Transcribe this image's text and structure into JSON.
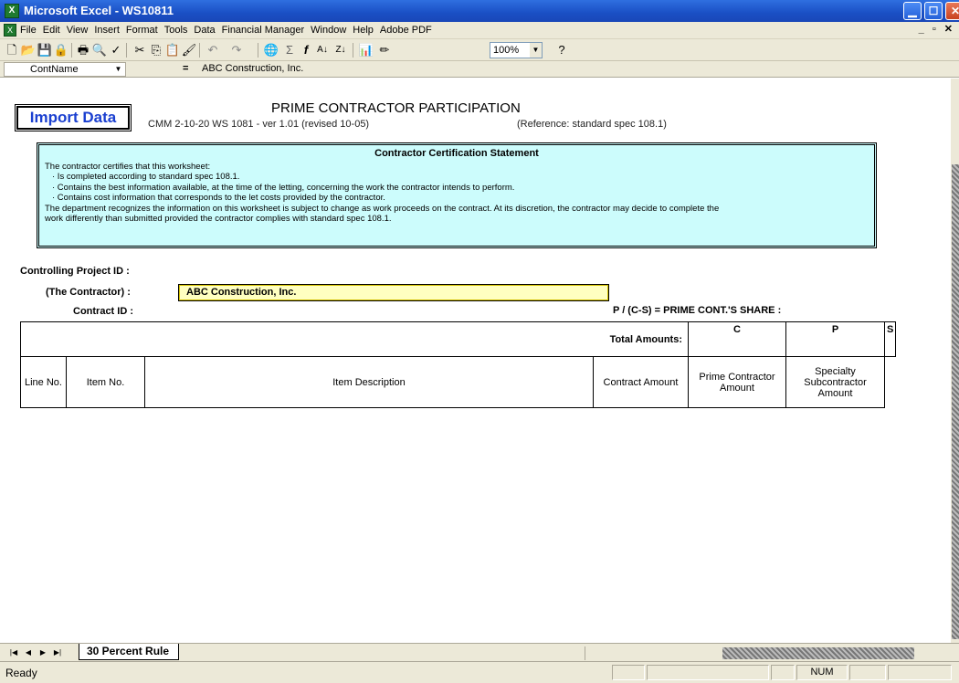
{
  "window": {
    "title": "Microsoft Excel - WS10811",
    "app_icon": "excel-icon",
    "controls": [
      "minimize",
      "maximize",
      "close"
    ]
  },
  "menu": {
    "items": [
      "File",
      "Edit",
      "View",
      "Insert",
      "Format",
      "Tools",
      "Data",
      "Financial Manager",
      "Window",
      "Help",
      "Adobe PDF"
    ]
  },
  "toolbar": {
    "zoom": "100%",
    "icons": [
      "new-icon",
      "open-icon",
      "save-icon",
      "permission-icon",
      "print-icon",
      "print-preview-icon",
      "spelling-icon",
      "cut-icon",
      "copy-icon",
      "paste-icon",
      "format-painter-icon",
      "undo-icon",
      "redo-icon",
      "hyperlink-icon",
      "autosum-icon",
      "function-icon",
      "sort-ascending-icon",
      "sort-descending-icon",
      "chart-wizard-icon",
      "drawing-icon",
      "help-icon"
    ]
  },
  "formula_bar": {
    "name_box": "ContName",
    "equals": "=",
    "content": "ABC Construction, Inc."
  },
  "sheet": {
    "import_button": "Import Data",
    "title": "PRIME CONTRACTOR PARTICIPATION",
    "version": "CMM 2-10-20 WS 1081 - ver 1.01 (revised 10-05)",
    "reference": "(Reference: standard spec 108.1)",
    "certification": {
      "title": "Contractor Certification Statement",
      "lines": [
        "The contractor certifies that this worksheet:",
        "· Is completed according to standard spec 108.1.",
        "· Contains the best information available, at the time of the letting, concerning the work the contractor intends to perform.",
        "· Contains cost information that corresponds to the let costs provided by the contractor.",
        "The department recognizes the information on this worksheet is subject to change as work proceeds on the contract.  At its discretion, the contractor may decide to complete the",
        "work differently than submitted provided the contractor complies with standard spec 108.1."
      ]
    },
    "controlling_project_label": "Controlling Project ID :",
    "contractor_label": "(The Contractor) :",
    "contractor_value": "ABC Construction, Inc.",
    "contract_id_label": "Contract ID :",
    "share_label": "P / (C-S) = PRIME CONT.'S SHARE :",
    "total_amounts_label": "Total Amounts:",
    "column_letters": {
      "c": "C",
      "p": "P",
      "s": "S"
    },
    "headers": {
      "line_no": "Line No.",
      "item_no": "Item No.",
      "item_description": "Item Description",
      "contract_amount": "Contract Amount",
      "prime_amount": "Prime Contractor Amount",
      "specialty_amount": "Specialty Subcontractor Amount"
    }
  },
  "tabs": {
    "active": "30 Percent Rule"
  },
  "status": {
    "text": "Ready",
    "num": "NUM"
  }
}
